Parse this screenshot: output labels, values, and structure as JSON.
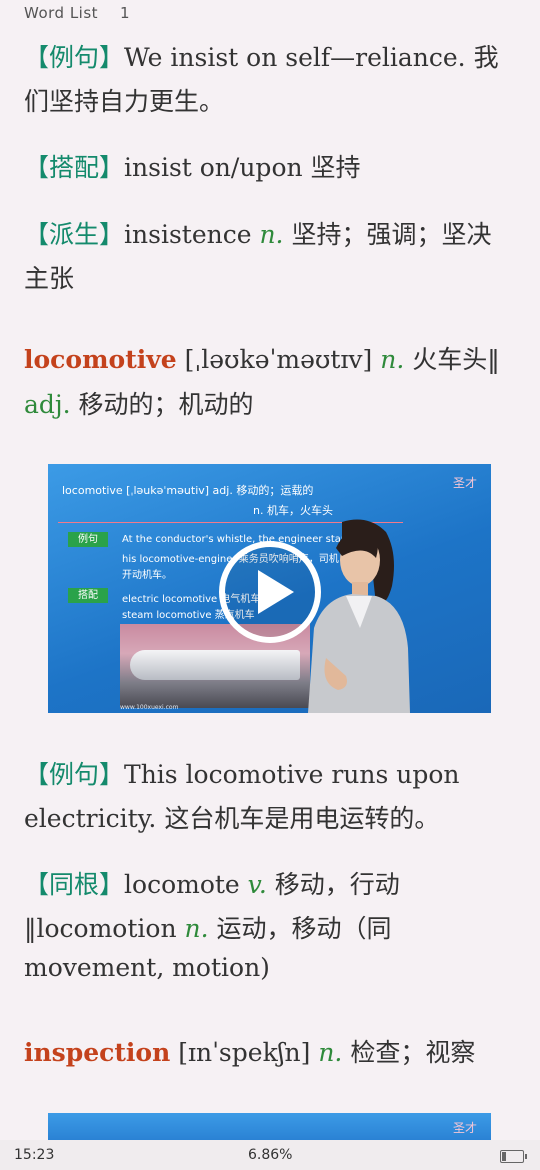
{
  "header": {
    "title": "Word List",
    "page": "1"
  },
  "entries": {
    "e1": {
      "tag": "【例句】",
      "text1": "We insist on self—reliance. 我",
      "text2": "们坚持自力更生。"
    },
    "e2": {
      "tag": "【搭配】",
      "text": "insist on/upon 坚持"
    },
    "e3": {
      "tag": "【派生】",
      "word": "insistence ",
      "pos": "n.",
      "meaning": " 坚持；强调；坚决",
      "meaning2": "主张"
    },
    "w1": {
      "headword": "locomotive",
      "phonetic": " [ˌləʊkəˈməʊtɪv] ",
      "pos1": "n.",
      "meaning1": " 火车头‖",
      "pos2": "adj.",
      "meaning2": " 移动的；机动的"
    },
    "e4": {
      "tag": "【例句】",
      "text1": "This locomotive runs upon",
      "text2": "electricity. 这台机车是用电运转的。"
    },
    "e5": {
      "tag": "【同根】",
      "word1": "locomote ",
      "pos1": "v.",
      "meaning1": " 移动，行动",
      "word2": "‖locomotion ",
      "pos2": "n.",
      "meaning2": " 运动，移动（同",
      "line3": "movement, motion)"
    },
    "w2": {
      "headword": "inspection",
      "phonetic": " [ɪnˈspekʃn] ",
      "pos": "n.",
      "meaning": " 检查；视察"
    }
  },
  "video": {
    "title": "locomotive [ˌləukəˈməutiv] adj. 移动的；运载的",
    "subtitle": "n. 机车，火车头",
    "tag1": "例句",
    "line1": "At the conductor's whistle, the engineer starts",
    "line2": "his locomotive-engine. 乘务员吹响哨声，司机",
    "line3": "开动机车。",
    "tag2": "搭配",
    "line4": "electric locomotive 电气机车",
    "line5": "steam locomotive 蒸汽机车",
    "brand": "圣才",
    "footer": "www.100xuexi.com"
  },
  "video2": {
    "brand": "圣才"
  },
  "status": {
    "time": "15:23",
    "progress": "6.86%",
    "battery_level": 0.2
  },
  "colors": {
    "tag": "#148a6c",
    "pos": "#2f8a3b",
    "headword": "#c4421c",
    "background": "#f6f1f4",
    "video": "#1d74c7"
  }
}
